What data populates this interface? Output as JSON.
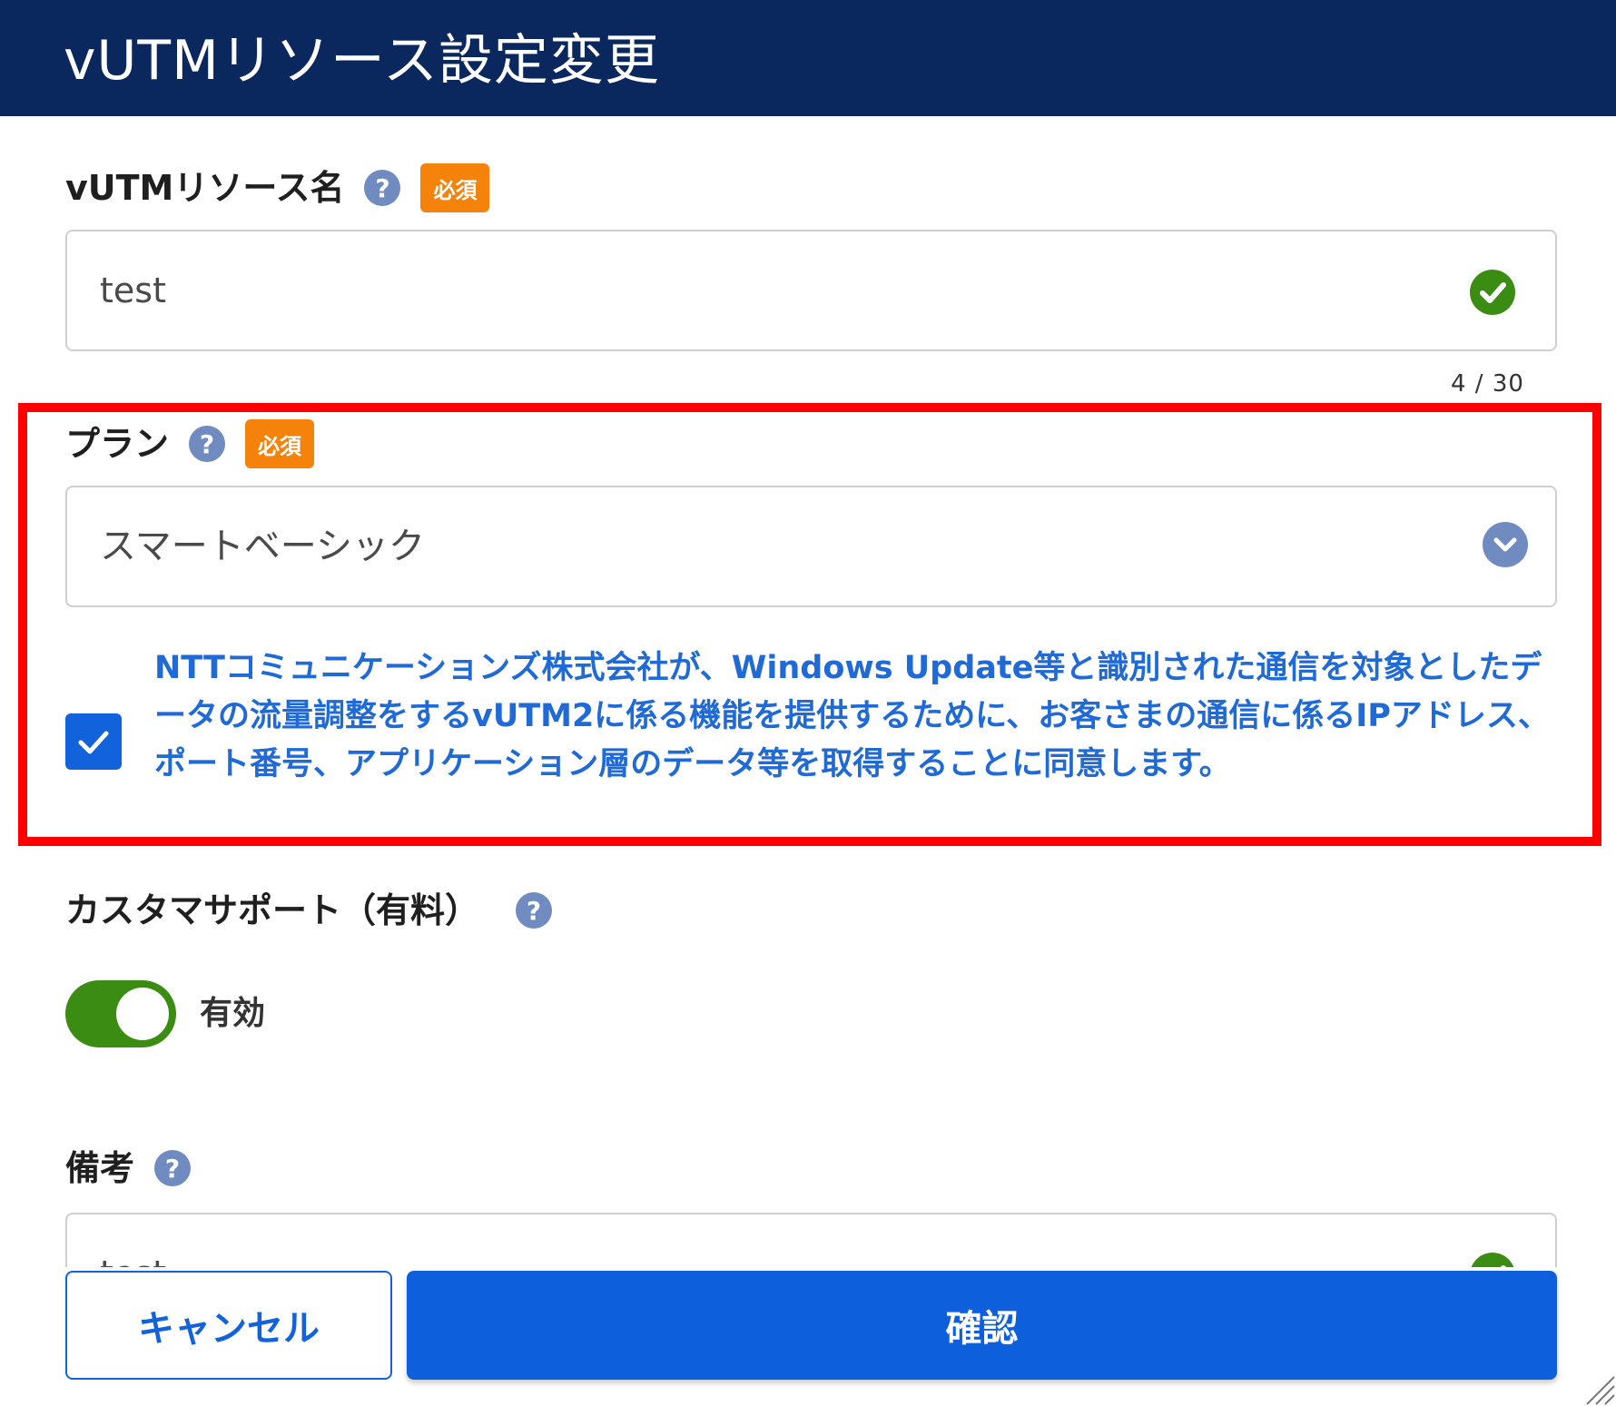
{
  "dialog": {
    "title": "vUTMリソース設定変更"
  },
  "resource_name": {
    "label": "vUTMリソース名",
    "required_badge": "必須",
    "value": "test",
    "char_count": "4 / 30"
  },
  "plan": {
    "label": "プラン",
    "required_badge": "必須",
    "selected": "スマートベーシック",
    "consent_checked": true,
    "consent_text": "NTTコミュニケーションズ株式会社が、Windows Update等と識別された通信を対象としたデータの流量調整をするvUTM2に係る機能を提供するために、お客さまの通信に係るIPアドレス、ポート番号、アプリケーション層のデータ等を取得することに同意します。"
  },
  "custom_support": {
    "label": "カスタマサポート（有料）",
    "toggle_on": true,
    "toggle_label": "有効"
  },
  "remarks": {
    "label": "備考",
    "value": "test"
  },
  "footer": {
    "cancel_label": "キャンセル",
    "confirm_label": "確認"
  },
  "colors": {
    "header_bg": "#0b285e",
    "required_badge": "#f5820b",
    "primary": "#1262dc",
    "success": "#3b8c12",
    "help_icon": "#6f8bc0",
    "highlight": "#ff0000"
  },
  "icons": [
    "help-icon",
    "check-circle-icon",
    "chevron-down-icon",
    "checkbox-check-icon",
    "resize-handle-icon"
  ]
}
